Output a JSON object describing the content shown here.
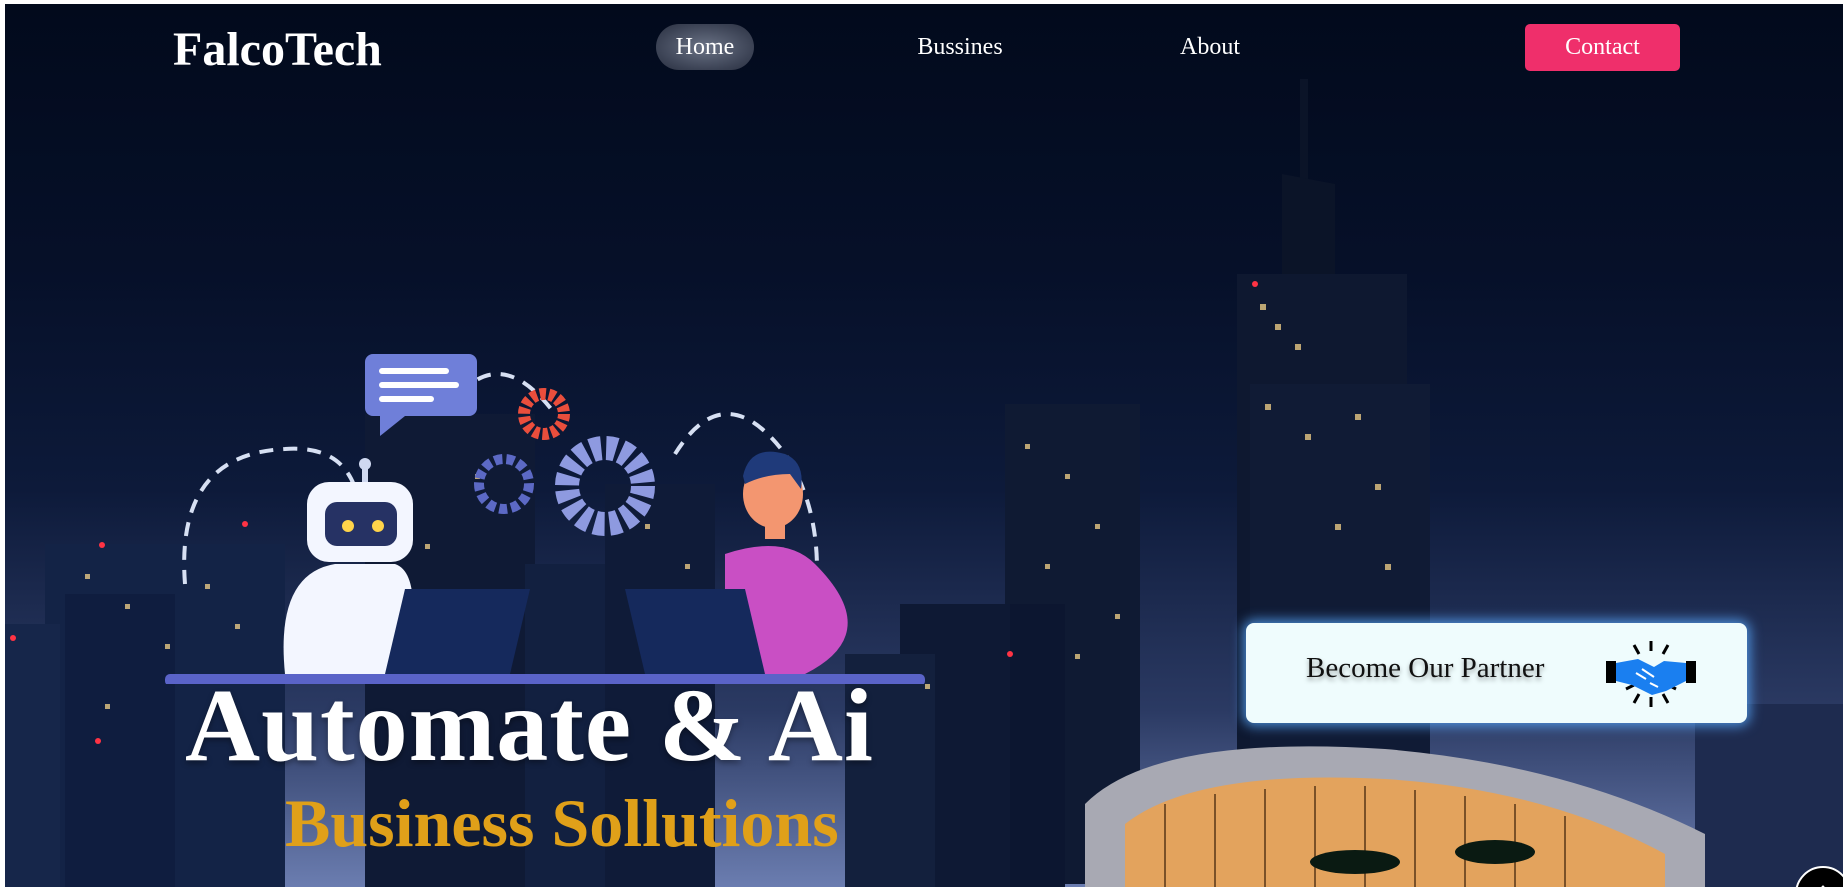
{
  "brand": {
    "logo": "FalcoTech"
  },
  "nav": {
    "items": [
      {
        "label": "Home",
        "active": true
      },
      {
        "label": "Bussines",
        "active": false
      },
      {
        "label": "About",
        "active": false
      }
    ],
    "contact_label": "Contact"
  },
  "hero": {
    "title": "Automate & Ai",
    "subtitle": "Business Sollutions"
  },
  "partner_card": {
    "label": "Become Our Partner",
    "icon": "handshake-icon"
  },
  "scroll_top": {
    "icon": "chevron-up-icon"
  },
  "colors": {
    "accent": "#ef2f6b",
    "subtitle": "#e0a019",
    "partner_glow": "#5aaaff"
  }
}
